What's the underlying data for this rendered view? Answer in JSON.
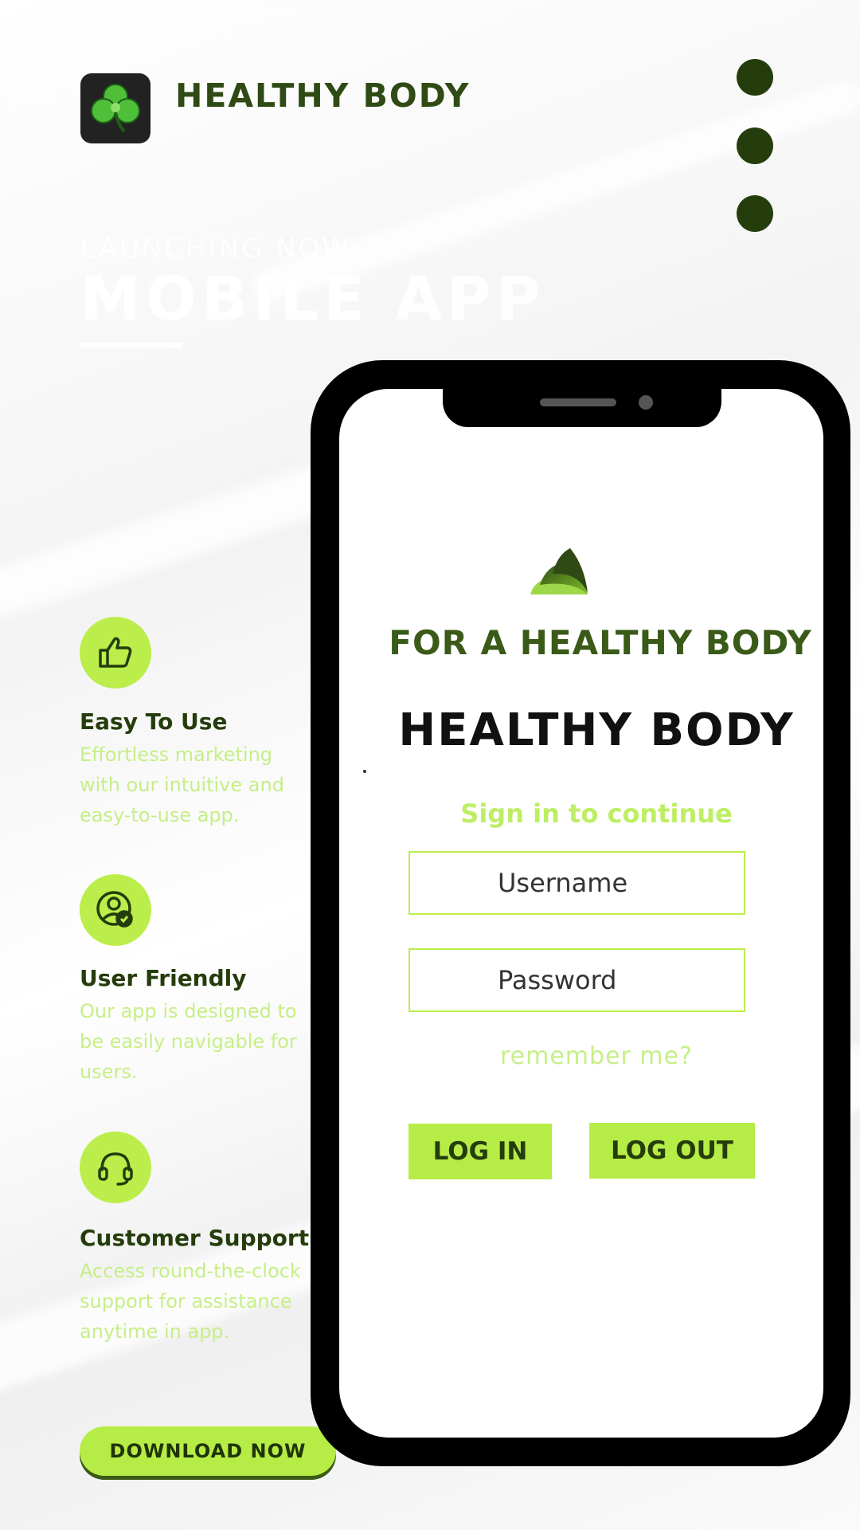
{
  "header": {
    "brand": "HEALTHY BODY",
    "logo_icon": "shamrock-icon",
    "menu_icon": "vertical-dots-menu-icon"
  },
  "hero": {
    "small": "LAUNCHING NOW",
    "big": "MOBILE APP"
  },
  "features": [
    {
      "icon": "thumbs-up-icon",
      "title": "Easy To Use",
      "desc": "Effortless marketing with our intuitive and easy-to-use app."
    },
    {
      "icon": "user-check-icon",
      "title": "User Friendly",
      "desc": "Our app is designed to be easily navigable for users."
    },
    {
      "icon": "headset-icon",
      "title": "Customer Support",
      "desc": "Access round-the-clock support for assistance anytime in app."
    }
  ],
  "download_label": "DOWNLOAD NOW",
  "phone": {
    "tagline": "FOR A HEALTHY BODY",
    "title": "HEALTHY BODY",
    "subtitle": "Sign in to continue",
    "username_placeholder": "Username",
    "password_placeholder": "Password",
    "remember": "remember me?",
    "login_label": "LOG IN",
    "logout_label": "LOG OUT"
  },
  "colors": {
    "accent": "#b6ec46",
    "dark_green": "#253d0c",
    "brand_green": "#2f4a14",
    "pale_green_text": "#c6ef86"
  }
}
